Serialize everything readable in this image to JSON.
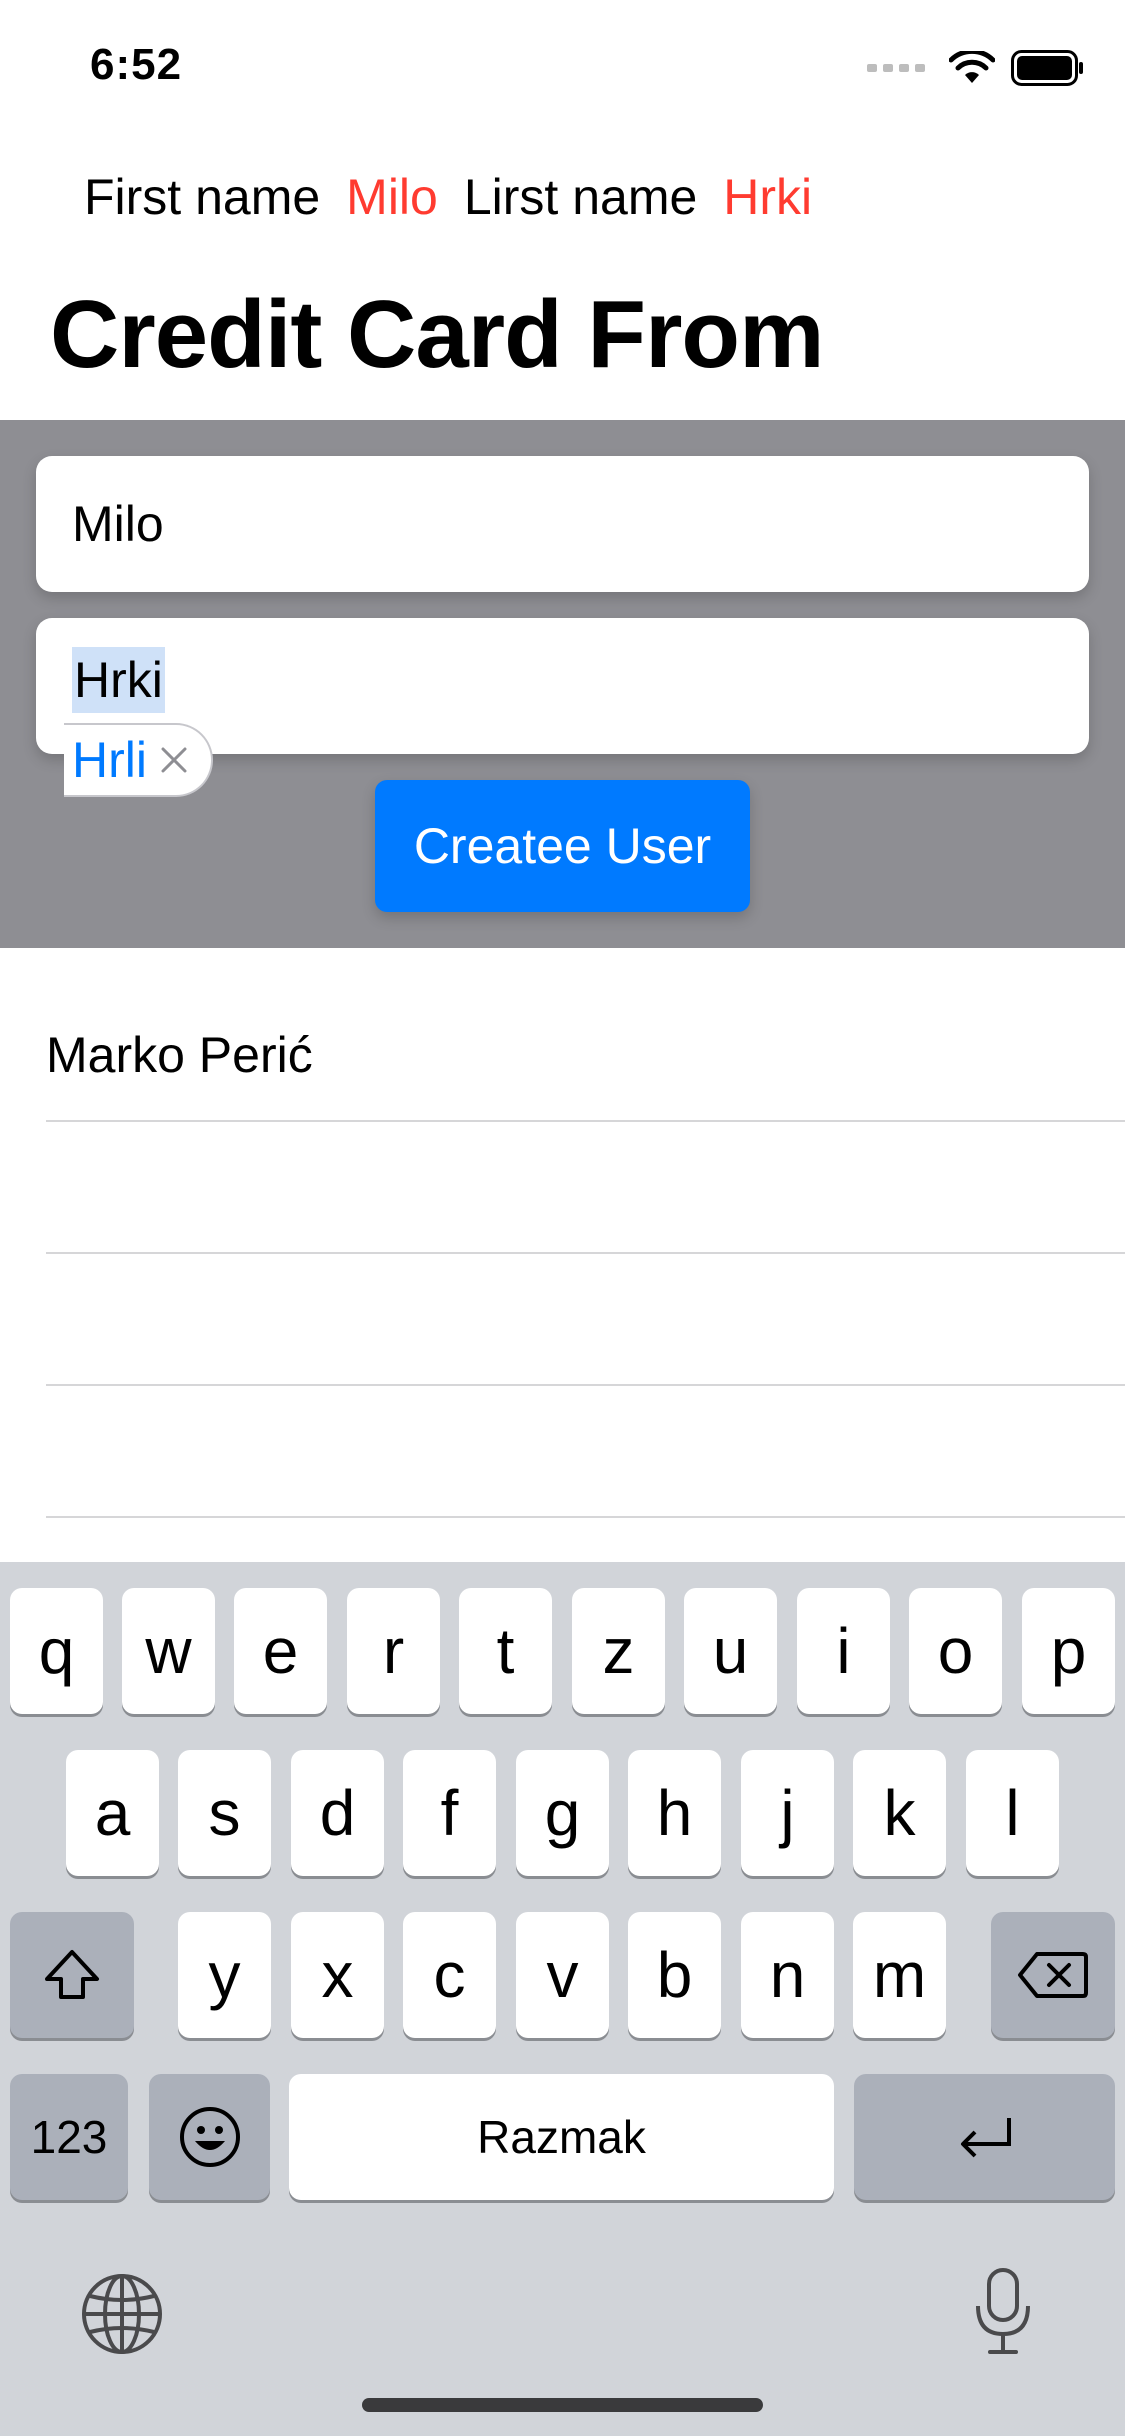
{
  "status_bar": {
    "time": "6:52"
  },
  "preview": {
    "first_label": "First name",
    "first_value": "Milo",
    "last_label": "Lirst name",
    "last_value": "Hrki"
  },
  "title": "Credit Card From",
  "form": {
    "first_name_value": "Milo",
    "last_name_value": "Hrki",
    "autocorrect_suggestion": "Hrli",
    "create_button_label": "Createe User"
  },
  "users": [
    {
      "name": "Marko Perić"
    },
    {
      "name": ""
    },
    {
      "name": ""
    },
    {
      "name": ""
    }
  ],
  "keyboard": {
    "row1": [
      "q",
      "w",
      "e",
      "r",
      "t",
      "z",
      "u",
      "i",
      "o",
      "p"
    ],
    "row2": [
      "a",
      "s",
      "d",
      "f",
      "g",
      "h",
      "j",
      "k",
      "l"
    ],
    "row3": [
      "y",
      "x",
      "c",
      "v",
      "b",
      "n",
      "m"
    ],
    "numbers_label": "123",
    "space_label": "Razmak"
  },
  "colors": {
    "accent": "#007aff",
    "preview_value": "#ff3b30",
    "panel": "#8e8e93",
    "keyboard_bg": "#d1d4d9"
  },
  "icons": [
    "wifi-icon",
    "battery-icon",
    "cellular-icon",
    "clear-x-icon",
    "shift-icon",
    "backspace-icon",
    "emoji-icon",
    "return-icon",
    "globe-icon",
    "microphone-icon"
  ]
}
